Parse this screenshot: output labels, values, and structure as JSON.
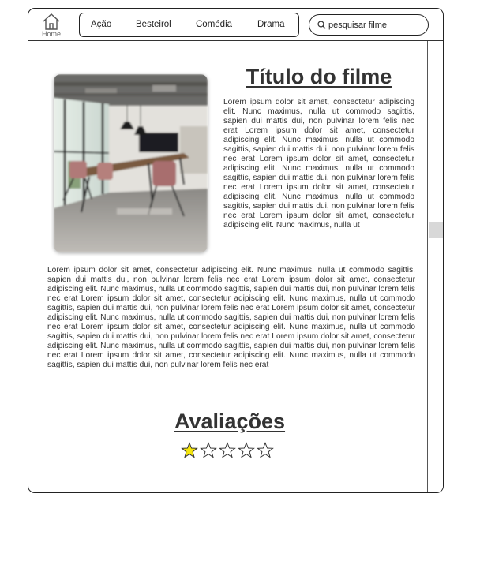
{
  "nav": {
    "home_label": "Home",
    "genres": [
      "Ação",
      "Besteirol",
      "Comédia",
      "Drama"
    ]
  },
  "search": {
    "value": "pesquisar filme"
  },
  "movie": {
    "title": "Título do filme",
    "synopsis_short": "Lorem ipsum dolor sit amet, consectetur adipiscing elit. Nunc maximus, nulla ut commodo sagittis, sapien dui mattis dui, non pulvinar lorem felis nec erat Lorem ipsum dolor sit amet, consectetur adipiscing elit. Nunc maximus, nulla ut commodo sagittis, sapien dui mattis dui, non pulvinar lorem felis nec erat Lorem ipsum dolor sit amet, consectetur adipiscing elit. Nunc maximus, nulla ut commodo sagittis, sapien dui mattis dui, non pulvinar lorem felis nec erat Lorem ipsum dolor sit amet, consectetur adipiscing elit. Nunc maximus, nulla ut commodo sagittis, sapien dui mattis dui, non pulvinar lorem felis nec erat Lorem ipsum dolor sit amet, consectetur adipiscing elit. Nunc maximus, nulla ut",
    "synopsis_long": "Lorem ipsum dolor sit amet, consectetur adipiscing elit. Nunc maximus, nulla ut commodo sagittis, sapien dui mattis dui, non pulvinar lorem felis nec erat Lorem ipsum dolor sit amet, consectetur adipiscing elit. Nunc maximus, nulla ut commodo sagittis, sapien dui mattis dui, non pulvinar lorem felis nec erat Lorem ipsum dolor sit amet, consectetur adipiscing elit. Nunc maximus, nulla ut commodo sagittis, sapien dui mattis dui, non pulvinar lorem felis nec erat Lorem ipsum dolor sit amet, consectetur adipiscing elit. Nunc maximus, nulla ut commodo sagittis, sapien dui mattis dui, non pulvinar lorem felis nec erat Lorem ipsum dolor sit amet, consectetur adipiscing elit. Nunc maximus, nulla ut commodo sagittis, sapien dui mattis dui, non pulvinar lorem felis nec erat Lorem ipsum dolor sit amet, consectetur adipiscing elit. Nunc maximus, nulla ut commodo sagittis, sapien dui mattis dui, non pulvinar lorem felis nec erat Lorem ipsum dolor sit amet, consectetur adipiscing elit. Nunc maximus, nulla ut commodo sagittis, sapien dui mattis dui, non pulvinar lorem felis nec erat"
  },
  "reviews": {
    "title": "Avaliações",
    "rating": 1,
    "max_rating": 5,
    "star_fill_color": "#f5e60c",
    "star_empty_color": "#ffffff"
  },
  "icons": {
    "home": "home-icon",
    "search": "search-icon",
    "star": "star-icon"
  }
}
